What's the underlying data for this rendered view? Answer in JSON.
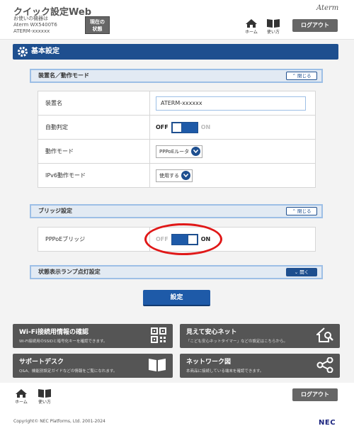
{
  "header": {
    "app_title": "クイック設定Web",
    "device_label": "お使いの機器は",
    "device_model": "Aterm WX5400T6",
    "device_name": "ATERM-xxxxxx",
    "status_button": "現在の\n状態",
    "brand": "Aterm",
    "home_label": "ホーム",
    "help_label": "使い方",
    "logout_label": "ログアウト"
  },
  "page": {
    "title": "基本設定",
    "submit_label": "設定"
  },
  "sections": {
    "device_mode": {
      "title": "装置名／動作モード",
      "toggle_label": "閉じる",
      "rows": {
        "device_name": {
          "label": "装置名",
          "value": "ATERM-xxxxxx"
        },
        "auto_detect": {
          "label": "自動判定",
          "off_label": "OFF",
          "on_label": "ON",
          "state": "off"
        },
        "operation_mode": {
          "label": "動作モード",
          "selected": "PPPoEルータ"
        },
        "ipv6_mode": {
          "label": "IPv6動作モード",
          "selected": "使用する"
        }
      }
    },
    "bridge": {
      "title": "ブリッジ設定",
      "toggle_label": "閉じる",
      "rows": {
        "pppoe_bridge": {
          "label": "PPPoEブリッジ",
          "off_label": "OFF",
          "on_label": "ON",
          "state": "on"
        }
      }
    },
    "lamp": {
      "title": "状態表示ランプ点灯設定",
      "toggle_label": "開く"
    }
  },
  "cards": [
    {
      "title": "Wi-Fi接続用情報の確認",
      "desc": "Wi-Fi接続用のSSIDと暗号化キーを確認できます。",
      "icon": "qr-code-icon"
    },
    {
      "title": "見えて安心ネット",
      "desc": "「こども安心ネットタイマー」などの設定はこちらから。",
      "icon": "home-search-icon"
    },
    {
      "title": "サポートデスク",
      "desc": "Q&A、機能別設定ガイドなどの情報をご覧になれます。",
      "icon": "book-icon"
    },
    {
      "title": "ネットワーク図",
      "desc": "本商品に接続している端末を確認できます。",
      "icon": "share-network-icon"
    }
  ],
  "footer": {
    "home_label": "ホーム",
    "help_label": "使い方",
    "logout_label": "ログアウト",
    "copyright": "Copyright© NEC Platforms, Ltd. 2001-2024",
    "company_logo": "NEC"
  },
  "colors": {
    "primary": "#1e5aa8",
    "header_dark": "#1e4f8f",
    "card_bg": "#555555",
    "highlight": "#e01818"
  }
}
